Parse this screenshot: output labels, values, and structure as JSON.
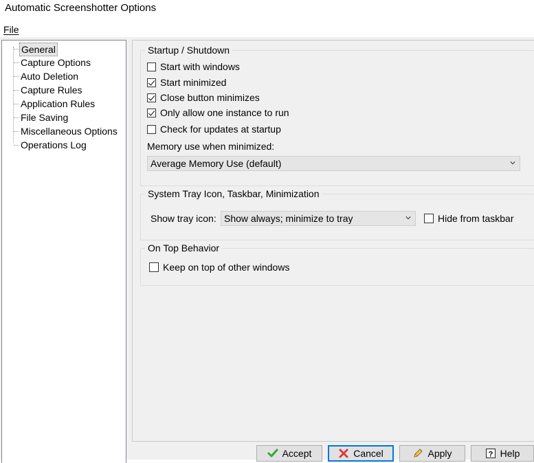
{
  "window": {
    "title": "Automatic Screenshotter Options"
  },
  "menu": {
    "file_label": "File"
  },
  "tree": {
    "items": [
      {
        "label": "General",
        "selected": true
      },
      {
        "label": "Capture Options"
      },
      {
        "label": "Auto Deletion"
      },
      {
        "label": "Capture Rules"
      },
      {
        "label": "Application Rules"
      },
      {
        "label": "File Saving"
      },
      {
        "label": "Miscellaneous Options"
      },
      {
        "label": "Operations Log"
      }
    ]
  },
  "startup": {
    "title": "Startup / Shutdown",
    "options": [
      {
        "label": "Start with windows",
        "checked": false
      },
      {
        "label": "Start minimized",
        "checked": true
      },
      {
        "label": "Close button minimizes",
        "checked": true
      },
      {
        "label": "Only allow one instance to run",
        "checked": true
      },
      {
        "label": "Check for updates at startup",
        "checked": false
      }
    ],
    "memory_label": "Memory use when minimized:",
    "memory_value": "Average Memory Use (default)"
  },
  "tray": {
    "title": "System Tray Icon, Taskbar, Minimization",
    "show_label": "Show tray icon:",
    "show_value": "Show always; minimize to tray",
    "hide_taskbar_label": "Hide from taskbar",
    "hide_taskbar_checked": false
  },
  "ontop": {
    "title": "On Top Behavior",
    "keep_label": "Keep on top of other windows",
    "keep_checked": false
  },
  "buttons": {
    "accept": "Accept",
    "cancel": "Cancel",
    "apply": "Apply",
    "help": "Help"
  },
  "icons": {
    "accept": "green-check-icon",
    "cancel": "red-x-icon",
    "apply": "pencil-icon",
    "help": "question-mark-icon"
  }
}
